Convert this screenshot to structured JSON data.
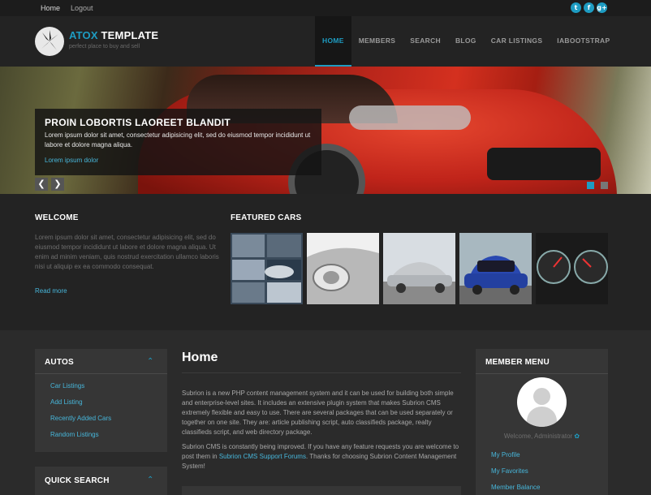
{
  "topbar": {
    "links": [
      "Home",
      "Logout"
    ],
    "social": [
      {
        "icon": "twitter-icon",
        "glyph": "t"
      },
      {
        "icon": "facebook-icon",
        "glyph": "f"
      },
      {
        "icon": "google-plus-icon",
        "glyph": "g+"
      }
    ]
  },
  "header": {
    "brand_accent": "ATOX",
    "brand_rest": " TEMPLATE",
    "tagline": "perfect place to buy and sell",
    "nav": [
      "HOME",
      "MEMBERS",
      "SEARCH",
      "BLOG",
      "CAR LISTINGS",
      "IABOOTSTRAP"
    ],
    "active_nav": "HOME"
  },
  "hero": {
    "title": "PROIN LOBORTIS LAOREET BLANDIT",
    "text": "Lorem ipsum dolor sit amet, consectetur adipisicing elit, sed do eiusmod tempor incididunt ut labore et dolore magna aliqua.",
    "link": "Lorem ipsum dolor",
    "prev_glyph": "❮",
    "next_glyph": "❯",
    "slide_count": 2,
    "active_slide": 1
  },
  "welcome": {
    "title": "WELCOME",
    "text": "Lorem ipsum dolor sit amet, consectetur adipisicing elit, sed do eiusmod tempor incididunt ut labore et dolore magna aliqua. Ut enim ad minim veniam, quis nostrud exercitation ullamco laboris nisi ut aliquip ex ea commodo consequat.",
    "read_more": "Read more"
  },
  "featured": {
    "title": "FEATURED CARS",
    "thumbs": [
      "car-collage",
      "car-headlight",
      "silver-sedan",
      "blue-hatchback",
      "dashboard-gauges"
    ]
  },
  "autos": {
    "title": "AUTOS",
    "links": [
      "Car Listings",
      "Add Listing",
      "Recently Added Cars",
      "Random Listings"
    ]
  },
  "quick_search": {
    "title": "QUICK SEARCH"
  },
  "content": {
    "title": "Home",
    "p1": "Subrion is a new PHP content management system and it can be used for building both simple and enterprise-level sites. It includes an extensive plugin system that makes Subrion CMS extremely flexible and easy to use. There are several packages that can be used separately or together on one site. They are: article publishing script, auto classifieds package, realty classifieds script, and web directory package.",
    "p2_before": "Subrion CMS is constantly being improved. If you have any feature requests you are welcome to post them in ",
    "p2_link": "Subrion CMS Support Forums",
    "p2_after": ". Thanks for choosing Subrion Content Management System!"
  },
  "member_menu": {
    "title": "MEMBER MENU",
    "welcome": "Welcome, Administrator",
    "gear_glyph": "✿",
    "links": [
      "My Profile",
      "My Favorites",
      "Member Balance"
    ]
  },
  "colors": {
    "accent": "#1e9cc2",
    "link": "#47b6da",
    "background": "#2b2b2b",
    "header": "#232323"
  }
}
